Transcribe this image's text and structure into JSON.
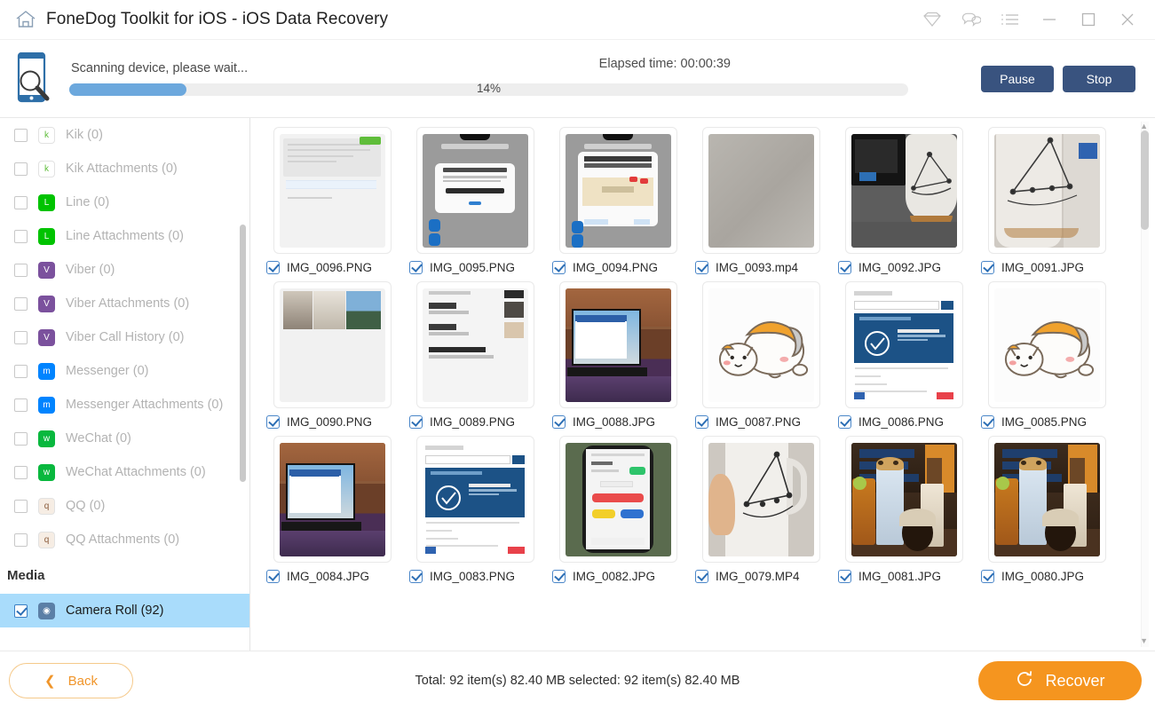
{
  "titlebar": {
    "app_title": "FoneDog Toolkit for iOS - iOS Data Recovery",
    "home_icon": "home-icon",
    "icons": [
      {
        "name": "diamond-icon",
        "glyph": "▽"
      },
      {
        "name": "chat-icon",
        "glyph": "○"
      },
      {
        "name": "list-menu-icon",
        "glyph": "≡"
      },
      {
        "name": "minimize-icon",
        "glyph": "─"
      },
      {
        "name": "maximize-icon",
        "glyph": "□"
      },
      {
        "name": "close-icon",
        "glyph": "✕"
      }
    ]
  },
  "scan": {
    "status_text": "Scanning device, please wait...",
    "progress_percent": "14%",
    "progress_value": 14,
    "elapsed_label": "Elapsed time: 00:00:39",
    "pause_label": "Pause",
    "stop_label": "Stop",
    "progress_color": "#6ca8dd",
    "button_color": "#39537f"
  },
  "sidebar": {
    "items": [
      {
        "label": "Kik (0)",
        "icon": "kik-icon",
        "icon_bg": "#ffffff",
        "icon_fg": "#5fbd3a",
        "glyph": "k",
        "checked": false,
        "selected": false
      },
      {
        "label": "Kik Attachments (0)",
        "icon": "kik-icon",
        "icon_bg": "#ffffff",
        "icon_fg": "#5fbd3a",
        "glyph": "k",
        "checked": false,
        "selected": false
      },
      {
        "label": "Line (0)",
        "icon": "line-icon",
        "icon_bg": "#00c300",
        "icon_fg": "#ffffff",
        "glyph": "L",
        "checked": false,
        "selected": false
      },
      {
        "label": "Line Attachments (0)",
        "icon": "line-icon",
        "icon_bg": "#00c300",
        "icon_fg": "#ffffff",
        "glyph": "L",
        "checked": false,
        "selected": false
      },
      {
        "label": "Viber (0)",
        "icon": "viber-icon",
        "icon_bg": "#7b519d",
        "icon_fg": "#ffffff",
        "glyph": "V",
        "checked": false,
        "selected": false
      },
      {
        "label": "Viber Attachments (0)",
        "icon": "viber-icon",
        "icon_bg": "#7b519d",
        "icon_fg": "#ffffff",
        "glyph": "V",
        "checked": false,
        "selected": false
      },
      {
        "label": "Viber Call History (0)",
        "icon": "viber-icon",
        "icon_bg": "#7b519d",
        "icon_fg": "#ffffff",
        "glyph": "V",
        "checked": false,
        "selected": false
      },
      {
        "label": "Messenger (0)",
        "icon": "messenger-icon",
        "icon_bg": "#0084ff",
        "icon_fg": "#ffffff",
        "glyph": "m",
        "checked": false,
        "selected": false
      },
      {
        "label": "Messenger Attachments (0)",
        "icon": "messenger-icon",
        "icon_bg": "#0084ff",
        "icon_fg": "#ffffff",
        "glyph": "m",
        "checked": false,
        "selected": false
      },
      {
        "label": "WeChat (0)",
        "icon": "wechat-icon",
        "icon_bg": "#09b83e",
        "icon_fg": "#ffffff",
        "glyph": "w",
        "checked": false,
        "selected": false
      },
      {
        "label": "WeChat Attachments (0)",
        "icon": "wechat-icon",
        "icon_bg": "#09b83e",
        "icon_fg": "#ffffff",
        "glyph": "w",
        "checked": false,
        "selected": false
      },
      {
        "label": "QQ (0)",
        "icon": "qq-icon",
        "icon_bg": "#f6ede4",
        "icon_fg": "#8a5a3a",
        "glyph": "q",
        "checked": false,
        "selected": false
      },
      {
        "label": "QQ Attachments (0)",
        "icon": "qq-icon",
        "icon_bg": "#f6ede4",
        "icon_fg": "#8a5a3a",
        "glyph": "q",
        "checked": false,
        "selected": false
      }
    ],
    "group_label": "Media",
    "selected_item": {
      "label": "Camera Roll (92)",
      "icon": "camera-icon",
      "icon_bg": "#5b7fa6",
      "icon_fg": "#ffffff",
      "glyph": "◉",
      "checked": true,
      "selected": true
    },
    "selected_bg": "#a9dcfb"
  },
  "grid": {
    "items": [
      {
        "filename": "IMG_0096.PNG",
        "checked": true,
        "art": "t-doc"
      },
      {
        "filename": "IMG_0095.PNG",
        "checked": true,
        "art": "t-dialog"
      },
      {
        "filename": "IMG_0094.PNG",
        "checked": true,
        "art": "t-dialog-map"
      },
      {
        "filename": "IMG_0093.mp4",
        "checked": true,
        "art": "t-gray"
      },
      {
        "filename": "IMG_0092.JPG",
        "checked": true,
        "art": "t-mug-desk"
      },
      {
        "filename": "IMG_0091.JPG",
        "checked": true,
        "art": "t-mug"
      },
      {
        "filename": "IMG_0090.PNG",
        "checked": true,
        "art": "t-photos"
      },
      {
        "filename": "IMG_0089.PNG",
        "checked": true,
        "art": "t-chatlist"
      },
      {
        "filename": "IMG_0088.JPG",
        "checked": true,
        "art": "t-desk"
      },
      {
        "filename": "IMG_0087.PNG",
        "checked": true,
        "art": "t-cat"
      },
      {
        "filename": "IMG_0086.PNG",
        "checked": true,
        "art": "t-blue"
      },
      {
        "filename": "IMG_0085.PNG",
        "checked": true,
        "art": "t-cat"
      },
      {
        "filename": "IMG_0084.JPG",
        "checked": true,
        "art": "t-desk"
      },
      {
        "filename": "IMG_0083.PNG",
        "checked": true,
        "art": "t-blue"
      },
      {
        "filename": "IMG_0082.JPG",
        "checked": true,
        "art": "t-phone"
      },
      {
        "filename": "IMG_0079.MP4",
        "checked": true,
        "art": "t-hand-mug"
      },
      {
        "filename": "IMG_0081.JPG",
        "checked": true,
        "art": "t-drink"
      },
      {
        "filename": "IMG_0080.JPG",
        "checked": true,
        "art": "t-drink"
      }
    ]
  },
  "footer": {
    "back_label": "Back",
    "total_text": "Total: 92 item(s) 82.40 MB   selected: 92 item(s) 82.40 MB",
    "recover_label": "Recover",
    "accent_color": "#f5951f"
  }
}
